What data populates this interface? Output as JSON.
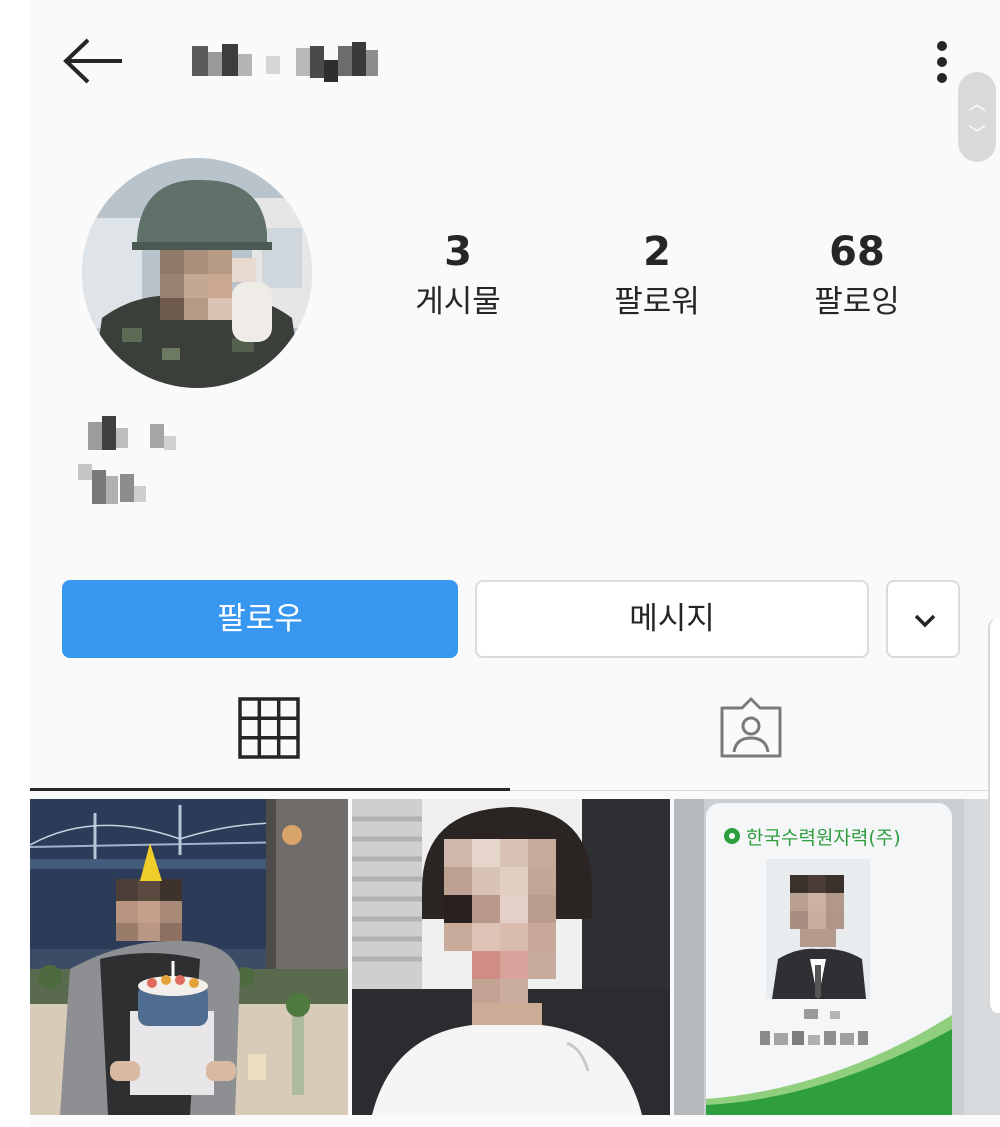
{
  "header": {
    "back_icon": "arrow-left-icon",
    "username": "dd_d_ld",
    "more_icon": "more-vertical-icon",
    "scroll_up_icon": "chevron-up-icon",
    "scroll_down_icon": "chevron-down-icon"
  },
  "profile": {
    "stats": [
      {
        "count": "3",
        "label": "게시물"
      },
      {
        "count": "2",
        "label": "팔로워"
      },
      {
        "count": "68",
        "label": "팔로잉"
      }
    ]
  },
  "actions": {
    "follow_label": "팔로우",
    "message_label": "메시지",
    "dropdown_icon": "chevron-down-icon"
  },
  "tabs": [
    {
      "icon": "grid-icon",
      "active": true
    },
    {
      "icon": "tagged-person-icon",
      "active": false
    }
  ],
  "posts": [
    {
      "kind": "birthday-cake-photo"
    },
    {
      "kind": "selfie-photo"
    },
    {
      "kind": "id-card-photo",
      "card_org": "한국수력원자력(주)"
    }
  ],
  "colors": {
    "accent": "#3897f0",
    "background": "#fafafa",
    "border": "#dbdbdb",
    "text": "#262626",
    "card_green": "#2e9e3f"
  }
}
